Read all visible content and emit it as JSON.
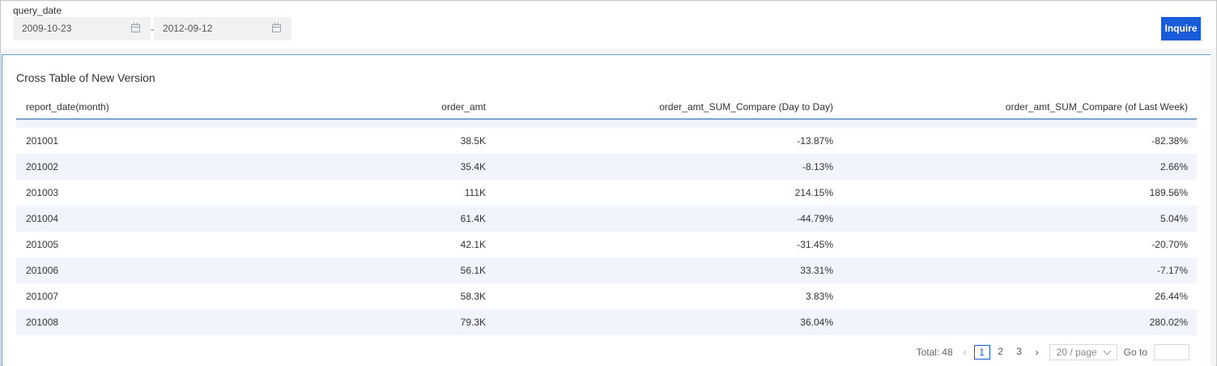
{
  "filter": {
    "label": "query_date",
    "start_date": "2009-10-23",
    "end_date": "2012-09-12",
    "separator": "-",
    "inquire_label": "Inquire"
  },
  "card": {
    "title": "Cross Table of New Version"
  },
  "table": {
    "headers": [
      "report_date(month)",
      "order_amt",
      "order_amt_SUM_Compare (Day to Day)",
      "order_amt_SUM_Compare (of Last Week)"
    ],
    "rows": [
      [
        "201001",
        "38.5K",
        "-13.87%",
        "-82.38%"
      ],
      [
        "201002",
        "35.4K",
        "-8.13%",
        "2.66%"
      ],
      [
        "201003",
        "111K",
        "214.15%",
        "189.56%"
      ],
      [
        "201004",
        "61.4K",
        "-44.79%",
        "5.04%"
      ],
      [
        "201005",
        "42.1K",
        "-31.45%",
        "-20.70%"
      ],
      [
        "201006",
        "56.1K",
        "33.31%",
        "-7.17%"
      ],
      [
        "201007",
        "58.3K",
        "3.83%",
        "26.44%"
      ],
      [
        "201008",
        "79.3K",
        "36.04%",
        "280.02%"
      ]
    ]
  },
  "pagination": {
    "total_label": "Total:",
    "total_count": "48",
    "pages": [
      "1",
      "2",
      "3"
    ],
    "current_page": "1",
    "page_size": "20 / page",
    "goto_label": "Go to",
    "goto_value": ""
  },
  "colors": {
    "accent": "#1a5bd9",
    "row_alt": "#f1f5fb",
    "header_border": "#7fa2c8"
  }
}
